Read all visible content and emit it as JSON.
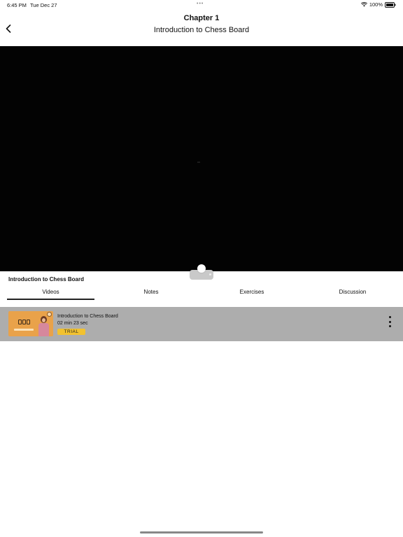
{
  "status_bar": {
    "time": "6:45 PM",
    "date": "Tue Dec 27",
    "dots": "•••",
    "battery": "100%"
  },
  "header": {
    "chapter": "Chapter 1",
    "lesson_title": "Introduction to  Chess Board",
    "back_icon": "chevron-left-icon"
  },
  "content": {
    "section_title": "Introduction to Chess Board",
    "tabs": [
      {
        "label": "Videos",
        "selected": true
      },
      {
        "label": "Notes",
        "selected": false
      },
      {
        "label": "Exercises",
        "selected": false
      },
      {
        "label": "Discussion",
        "selected": false
      }
    ],
    "videos": [
      {
        "title": "Introduction to Chess Board",
        "duration": "02 min 23 sec",
        "badge": "TRIAL"
      }
    ]
  },
  "colors": {
    "video_background": "#030303",
    "row_highlight": "#adadad",
    "trial_badge": "#f2c230",
    "thumbnail": "#e9a24a"
  }
}
